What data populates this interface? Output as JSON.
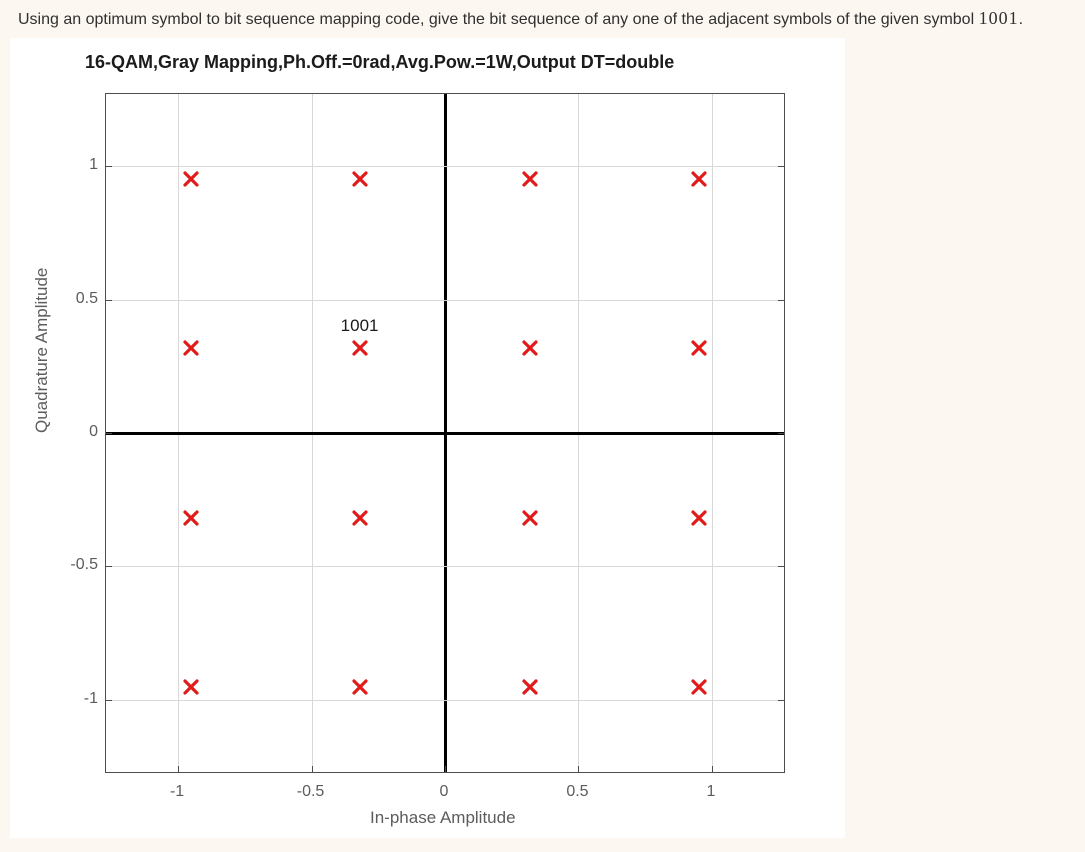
{
  "question": {
    "text_before": "Using an optimum symbol to bit sequence mapping code, give the bit sequence of any one of the adjacent symbols of the given symbol ",
    "symbol": "1001",
    "text_after": "."
  },
  "chart_data": {
    "type": "scatter",
    "title": "16-QAM,Gray Mapping,Ph.Off.=0rad,Avg.Pow.=1W,Output DT=double",
    "xlabel": "In-phase Amplitude",
    "ylabel": "Quadrature Amplitude",
    "xlim": [
      -1.27,
      1.27
    ],
    "ylim": [
      -1.27,
      1.27
    ],
    "xticks": [
      -1,
      -0.5,
      0,
      0.5,
      1
    ],
    "yticks": [
      -1,
      -0.5,
      0,
      0.5,
      1
    ],
    "grid": true,
    "marker": "x",
    "marker_color": "#e11a1a",
    "series": [
      {
        "name": "constellation",
        "points": [
          {
            "x": -0.95,
            "y": 0.95
          },
          {
            "x": -0.32,
            "y": 0.95
          },
          {
            "x": 0.32,
            "y": 0.95
          },
          {
            "x": 0.95,
            "y": 0.95
          },
          {
            "x": -0.95,
            "y": 0.32
          },
          {
            "x": -0.32,
            "y": 0.32,
            "label": "1001"
          },
          {
            "x": 0.32,
            "y": 0.32
          },
          {
            "x": 0.95,
            "y": 0.32
          },
          {
            "x": -0.95,
            "y": -0.32
          },
          {
            "x": -0.32,
            "y": -0.32
          },
          {
            "x": 0.32,
            "y": -0.32
          },
          {
            "x": 0.95,
            "y": -0.32
          },
          {
            "x": -0.95,
            "y": -0.95
          },
          {
            "x": -0.32,
            "y": -0.95
          },
          {
            "x": 0.32,
            "y": -0.95
          },
          {
            "x": 0.95,
            "y": -0.95
          }
        ]
      }
    ]
  }
}
